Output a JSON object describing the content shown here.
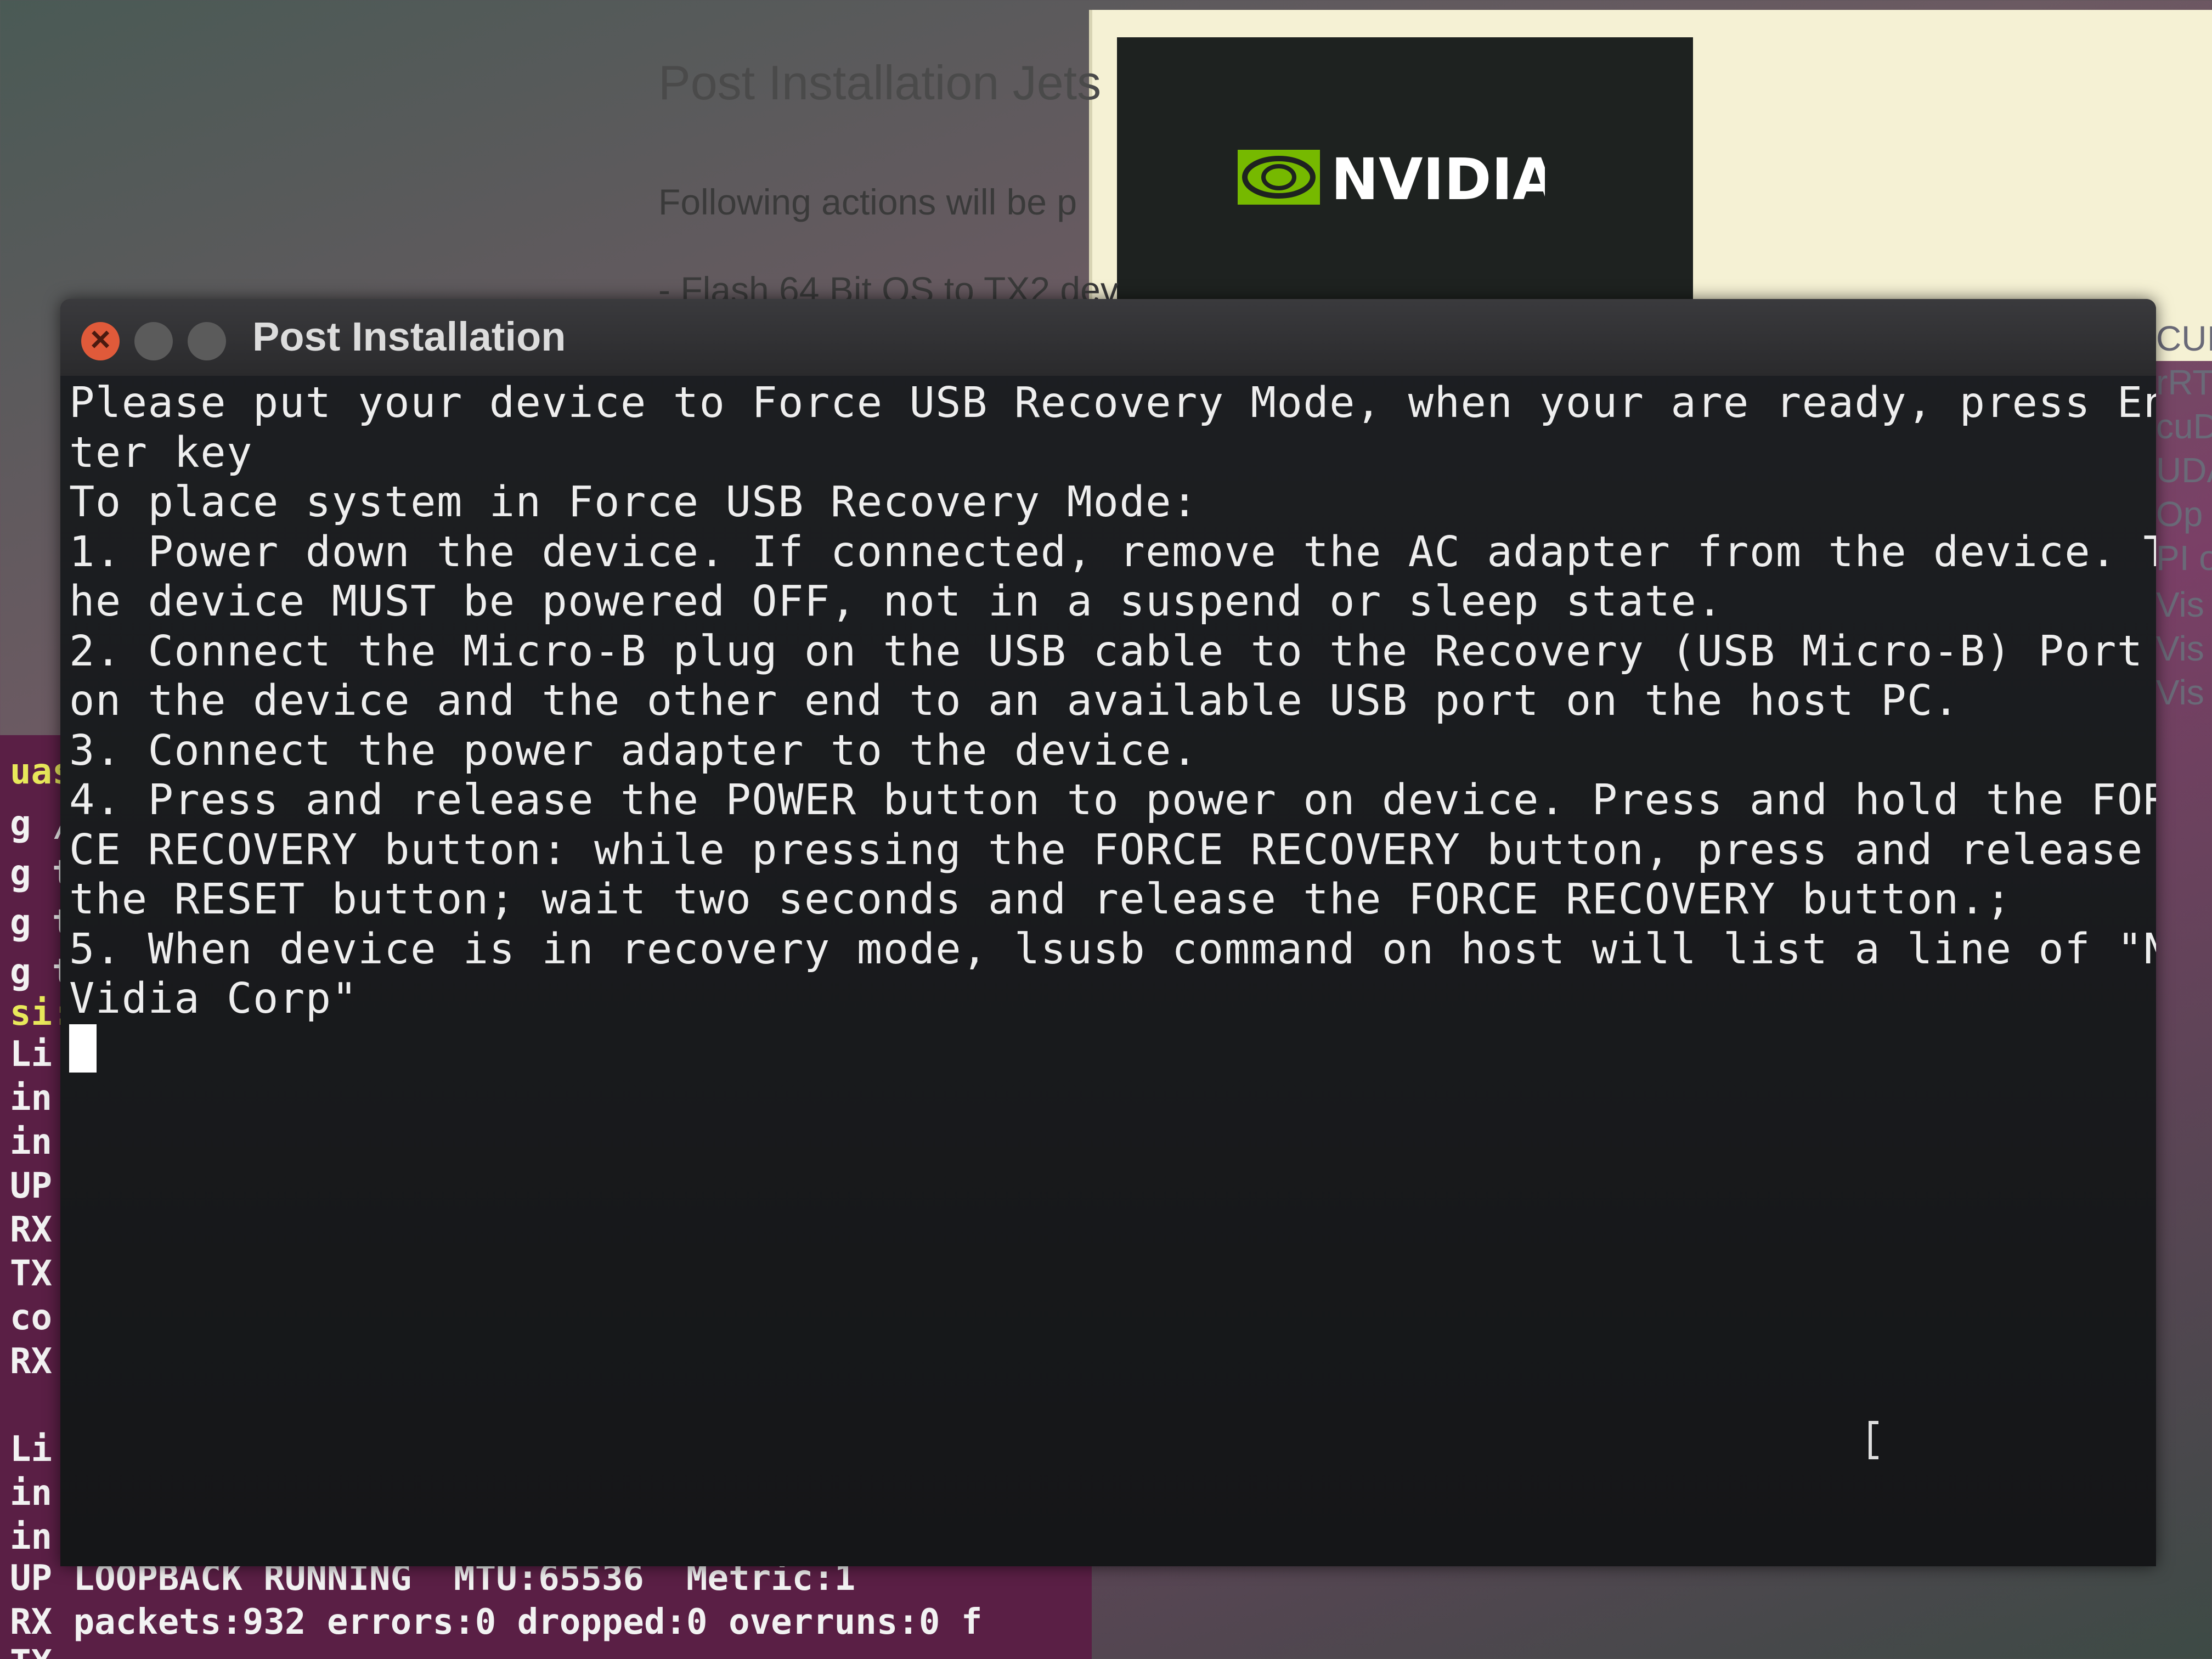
{
  "installer": {
    "logo_text": "NVIDIA",
    "title": "Post Installation Jets",
    "subtitle": "Following actions will be p",
    "actions_partial": "- Flash 64 Bit OS to TX2 dev",
    "side_items": [
      "CUI",
      "rRT",
      "cuD",
      "UDA",
      "Op",
      "PI o",
      "Vis",
      "Vis",
      "Vis"
    ]
  },
  "background_terminal": {
    "prompt_fragment": "uasi",
    "lines": [
      "g /",
      "g t",
      "g t",
      "g t"
    ],
    "prompt2": "si:",
    "left_column": [
      "Li",
      "in",
      "in",
      "UP",
      "RX",
      "TX",
      "co",
      "RX",
      "",
      "Li",
      "in",
      "in"
    ],
    "bottom_lines": [
      "UP LOOPBACK RUNNING  MTU:65536  Metric:1",
      "RX packets:932 errors:0 dropped:0 overruns:0 f",
      "TX"
    ]
  },
  "terminal": {
    "title": "Post Installation",
    "lines": [
      "Please put your device to Force USB Recovery Mode, when your are ready, press En",
      "ter key",
      "To place system in Force USB Recovery Mode:",
      "1. Power down the device. If connected, remove the AC adapter from the device. T",
      "he device MUST be powered OFF, not in a suspend or sleep state.",
      "2. Connect the Micro-B plug on the USB cable to the Recovery (USB Micro-B) Port",
      "on the device and the other end to an available USB port on the host PC.",
      "3. Connect the power adapter to the device.",
      "4. Press and release the POWER button to power on device. Press and hold the FOR",
      "CE RECOVERY button: while pressing the FORCE RECOVERY button, press and release",
      "the RESET button; wait two seconds and release the FORCE RECOVERY button.;",
      "5. When device is in recovery mode, lsusb command on host will list a line of \"N",
      "Vidia Corp\""
    ]
  },
  "colors": {
    "terminal_bg": "#1a1b1d",
    "terminal_text": "#eeeeee",
    "close_button": "#e05a3a",
    "nvidia_green": "#76b900",
    "bg_terminal_purple": "#5a1f45"
  }
}
